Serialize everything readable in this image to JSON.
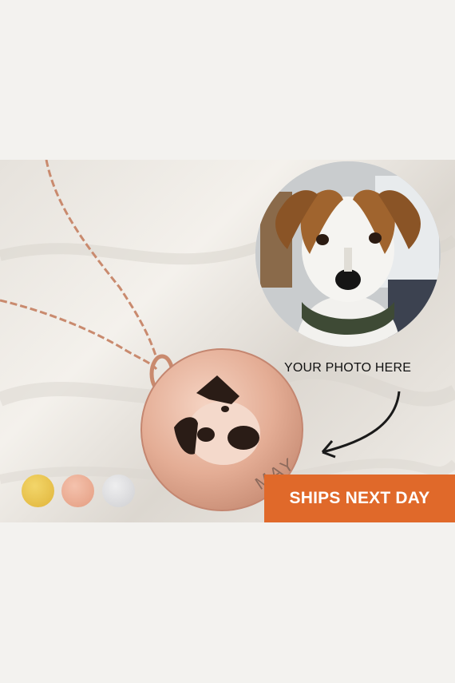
{
  "caption": "YOUR PHOTO HERE",
  "engraving": "MAY",
  "badge": "SHIPS NEXT DAY",
  "swatches": [
    {
      "name": "gold",
      "color": "#e6bd45"
    },
    {
      "name": "rose-gold",
      "color": "#e9a78d"
    },
    {
      "name": "silver",
      "color": "#d6d6d8"
    }
  ],
  "colors": {
    "badge": "#e0692a",
    "chain": "#c98a6e",
    "pendant": "#e6b49c"
  }
}
